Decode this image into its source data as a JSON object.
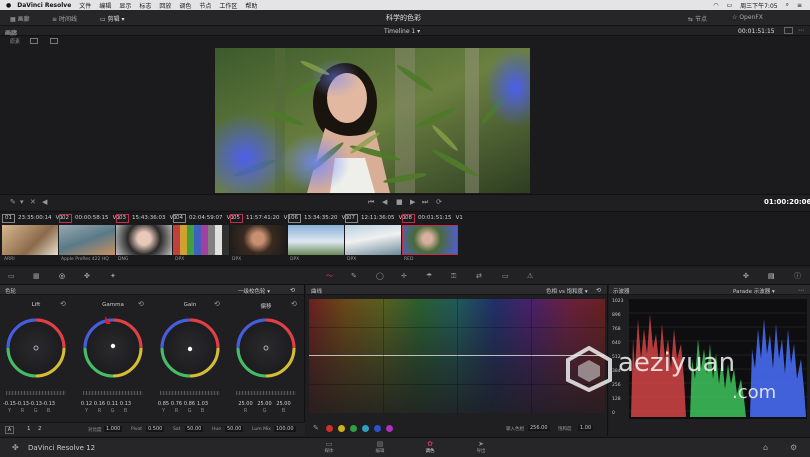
{
  "macbar": {
    "app": "DaVinci Resolve",
    "menus": [
      "文件",
      "编辑",
      "显示",
      "标志",
      "回放",
      "调色",
      "节点",
      "工作区",
      "帮助"
    ],
    "clock": "周三下午7:05"
  },
  "apptop": {
    "left_buttons": [
      "画廊",
      "时间线"
    ],
    "clip_button": "剪辑",
    "project_title": "科学的色彩",
    "right_buttons": [
      "节点",
      "OpenFX"
    ]
  },
  "subbar": {
    "left": "画廊",
    "timeline": "Timeline 1",
    "timecode": "00:01:51:15"
  },
  "toolrow": {
    "left_label": "原素"
  },
  "transport": {
    "timecode": "01:00:20:06"
  },
  "clips": [
    {
      "num": "01",
      "tc": "23:35:00:14",
      "track": "V1",
      "fmt": "ARRI",
      "red": false
    },
    {
      "num": "02",
      "tc": "00:00:58:15",
      "track": "V1",
      "fmt": "Apple ProRes 422 HQ",
      "red": true
    },
    {
      "num": "03",
      "tc": "15:43:36:03",
      "track": "V1",
      "fmt": "DNG",
      "red": true
    },
    {
      "num": "04",
      "tc": "02:04:59:07",
      "track": "V1",
      "fmt": "DPX",
      "red": false
    },
    {
      "num": "05",
      "tc": "11:57:41:20",
      "track": "V1",
      "fmt": "DPX",
      "red": true
    },
    {
      "num": "06",
      "tc": "13:34:35:20",
      "track": "V1",
      "fmt": "DPX",
      "red": false
    },
    {
      "num": "07",
      "tc": "12:11:36:05",
      "track": "V1",
      "fmt": "DPX",
      "red": false
    },
    {
      "num": "08",
      "tc": "00:01:51:15",
      "track": "V1",
      "fmt": "RED",
      "red": true
    }
  ],
  "wheels": {
    "title": "色轮",
    "mode": "一级校色轮",
    "items": [
      {
        "name": "Lift",
        "values": [
          "-0.15",
          "-0.13",
          "-0.13",
          "-0.13"
        ]
      },
      {
        "name": "Gamma",
        "values": [
          "0.12",
          "0.16",
          "0.11",
          "0.13"
        ]
      },
      {
        "name": "Gain",
        "values": [
          "0.85",
          "0.76",
          "0.86",
          "1.03"
        ]
      },
      {
        "name": "偏移",
        "values": [
          "25.00",
          "25.00",
          "25.00",
          ""
        ]
      }
    ],
    "channel_labels": [
      "Y",
      "R",
      "G",
      "B"
    ],
    "footer": {
      "page_a": "A",
      "page1": "1",
      "page2": "2",
      "contrast_label": "对比度",
      "contrast": "1.000",
      "pivot_label": "Pivot",
      "pivot": "0.500",
      "sat_label": "Sat",
      "sat": "50.00",
      "hue_label": "Hue",
      "hue": "50.00",
      "lummix_label": "Lum Mix",
      "lummix": "100.00"
    }
  },
  "curves": {
    "title": "曲线",
    "mode": "色相 vs 饱和度",
    "input_label": "输入色相",
    "input_value": "256.00",
    "sat_label": "饱和度",
    "sat_value": "1.00",
    "swatches": [
      "#d0302b",
      "#d0b020",
      "#30a040",
      "#30a0c0",
      "#3050d0",
      "#b030c0"
    ]
  },
  "scope": {
    "title": "示波器",
    "mode": "Parade 示波器",
    "ticks": [
      "1023",
      "896",
      "768",
      "640",
      "512",
      "384",
      "256",
      "128",
      "0"
    ]
  },
  "bottombar": {
    "app_name": "DaVinci Resolve 12",
    "pages": [
      "媒体",
      "编辑",
      "调色",
      "导出"
    ],
    "active_page": "调色"
  },
  "watermark": {
    "text1": "aeziyuan",
    "text2": ".com"
  },
  "colors": {
    "accent": "#c0304a",
    "active_page": "#d0305a"
  }
}
